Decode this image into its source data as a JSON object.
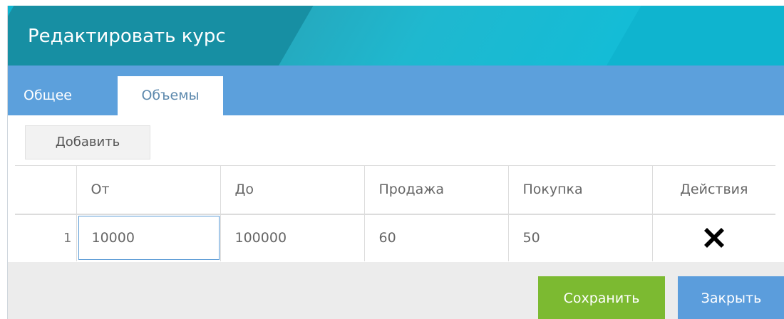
{
  "dialog": {
    "title": "Редактировать курс"
  },
  "tabs": [
    {
      "label": "Общее",
      "active": false
    },
    {
      "label": "Объемы",
      "active": true
    }
  ],
  "toolbar": {
    "add_label": "Добавить"
  },
  "table": {
    "columns": [
      "От",
      "До",
      "Продажа",
      "Покупка",
      "Действия"
    ],
    "rows": [
      {
        "num": "1",
        "from": "10000",
        "to": "100000",
        "sell": "60",
        "buy": "50",
        "action_icon": "delete-icon"
      }
    ]
  },
  "footer": {
    "save_label": "Сохранить",
    "close_label": "Закрыть"
  },
  "colors": {
    "header": "#0fb4cf",
    "header_dark": "#178fa3",
    "tabbar": "#5ca0dc",
    "save": "#7cba31",
    "close": "#5b9ddc",
    "input_border": "#5b9bd5"
  }
}
